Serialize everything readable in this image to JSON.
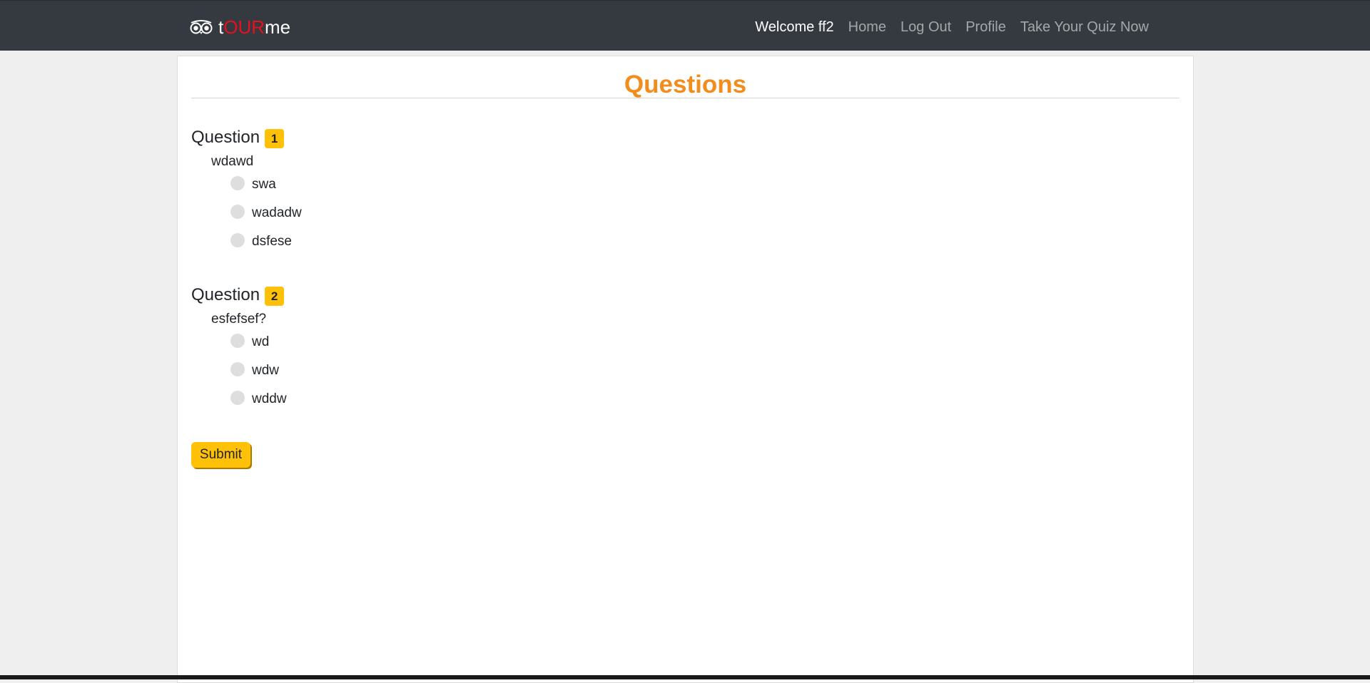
{
  "navbar": {
    "brand": {
      "prefix": "t",
      "accent": "OUR",
      "suffix": "me"
    },
    "welcome": "Welcome ff2",
    "links": [
      "Home",
      "Log Out",
      "Profile",
      "Take Your Quiz Now"
    ]
  },
  "page": {
    "title": "Questions",
    "title_color": "#f28c1c"
  },
  "questions": [
    {
      "label": "Question",
      "number": "1",
      "text": "wdawd",
      "options": [
        "swa",
        "wadadw",
        "dsfese"
      ]
    },
    {
      "label": "Question",
      "number": "2",
      "text": "esfefsef?",
      "options": [
        "wd",
        "wdw",
        "wddw"
      ]
    }
  ],
  "form": {
    "submit_label": "Submit"
  },
  "colors": {
    "navbar_bg": "#343a40",
    "brand_accent": "#e8101d",
    "badge": "#ffc107",
    "submit": "#ffc107"
  },
  "icons": {
    "brand_icon": "owl-eyes-icon"
  }
}
